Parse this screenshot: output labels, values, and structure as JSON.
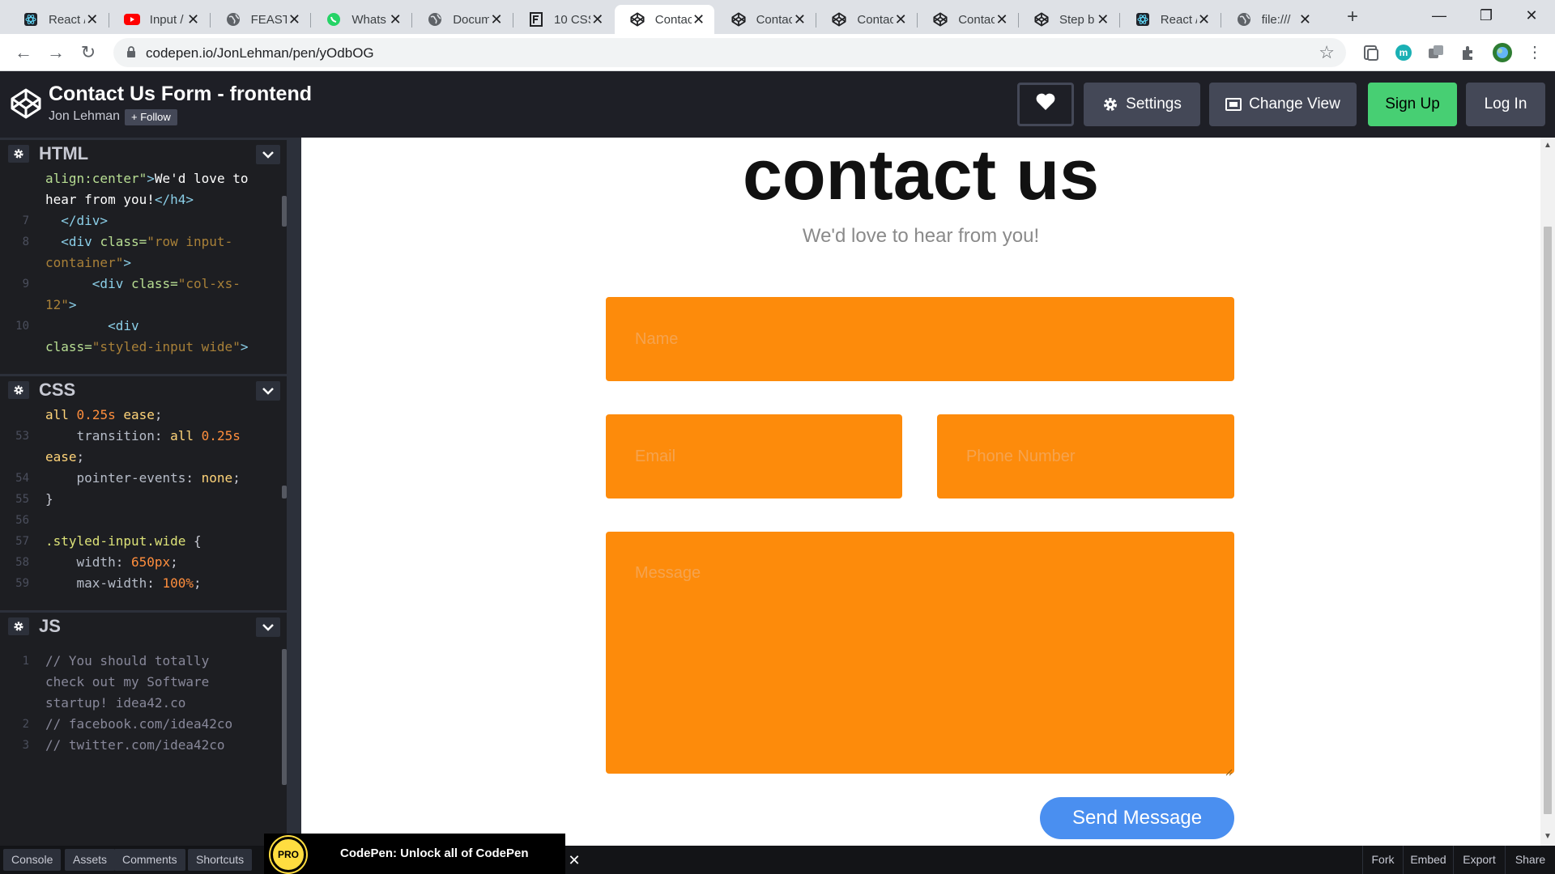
{
  "browser": {
    "tabs": [
      {
        "label": "React /",
        "icon": "react-icon"
      },
      {
        "label": "Input /",
        "icon": "youtube-icon"
      },
      {
        "label": "FEAST_",
        "icon": "globe-icon"
      },
      {
        "label": "Whats",
        "icon": "whatsapp-icon"
      },
      {
        "label": "Docum",
        "icon": "globe-icon"
      },
      {
        "label": "10 CSS",
        "icon": "fcc-icon"
      },
      {
        "label": "Contac",
        "icon": "codepen-icon",
        "active": true
      },
      {
        "label": "Contac",
        "icon": "codepen-icon"
      },
      {
        "label": "Contac",
        "icon": "codepen-icon"
      },
      {
        "label": "Contac",
        "icon": "codepen-icon"
      },
      {
        "label": "Step b",
        "icon": "codepen-icon"
      },
      {
        "label": "React /",
        "icon": "react-icon"
      },
      {
        "label": "file:///",
        "icon": "globe-icon"
      }
    ],
    "url": "codepen.io/JonLehman/pen/yOdbOG"
  },
  "header": {
    "title": "Contact Us Form - frontend",
    "author": "Jon Lehman",
    "follow_label": "+ Follow",
    "settings_label": "Settings",
    "change_view_label": "Change View",
    "signup_label": "Sign Up",
    "login_label": "Log In"
  },
  "panes": {
    "html": {
      "name": "HTML",
      "lines": [
        {
          "n": "",
          "html": "<span class=\"at\">align:center\"</span><span class=\"tg\">&gt;</span><span class=\"tx\">We'd love to</span>"
        },
        {
          "n": "",
          "html": "<span class=\"tx\">hear from you!</span><span class=\"tg\">&lt;/h4&gt;</span>"
        },
        {
          "n": "7",
          "html": "  <span class=\"tg\">&lt;/div&gt;</span>"
        },
        {
          "n": "8",
          "html": "  <span class=\"tg\">&lt;div</span> <span class=\"at\">class=</span><span class=\"st\">\"row input-</span>"
        },
        {
          "n": "",
          "html": "<span class=\"st\">container\"</span><span class=\"tg\">&gt;</span>"
        },
        {
          "n": "9",
          "html": "      <span class=\"tg\">&lt;div</span> <span class=\"at\">class=</span><span class=\"st\">\"col-xs-</span>"
        },
        {
          "n": "",
          "html": "<span class=\"st\">12\"</span><span class=\"tg\">&gt;</span>"
        },
        {
          "n": "10",
          "html": "        <span class=\"tg\">&lt;div</span>"
        },
        {
          "n": "",
          "html": "<span class=\"at\">class=</span><span class=\"st\">\"styled-input wide\"</span><span class=\"tg\">&gt;</span>"
        }
      ]
    },
    "css": {
      "name": "CSS",
      "lines": [
        {
          "n": "",
          "html": "<span class=\"vl\">all</span> <span class=\"num\">0.25s</span> <span class=\"vl\">ease</span>;"
        },
        {
          "n": "53",
          "html": "    <span class=\"pr\">transition</span>: <span class=\"vl\">all</span> <span class=\"num\">0.25s</span>"
        },
        {
          "n": "",
          "html": "<span class=\"vl\">ease</span>;"
        },
        {
          "n": "54",
          "html": "    <span class=\"pr\">pointer-events</span>: <span class=\"vl\">none</span>;"
        },
        {
          "n": "55",
          "html": "}"
        },
        {
          "n": "56",
          "html": ""
        },
        {
          "n": "57",
          "html": "<span class=\"sel\">.styled-input.wide</span> {"
        },
        {
          "n": "58",
          "html": "    <span class=\"pr\">width</span>: <span class=\"num\">650px</span>;"
        },
        {
          "n": "59",
          "html": "    <span class=\"pr\">max-width</span>: <span class=\"num\">100%</span>;"
        }
      ]
    },
    "js": {
      "name": "JS",
      "lines": [
        {
          "n": "1",
          "html": "<span class=\"cm\">// You should totally</span>"
        },
        {
          "n": "",
          "html": "<span class=\"cm\">check out my Software</span>"
        },
        {
          "n": "",
          "html": "<span class=\"cm\">startup! idea42.co</span>"
        },
        {
          "n": "2",
          "html": "<span class=\"cm\">// facebook.com/idea42co</span>"
        },
        {
          "n": "3",
          "html": "<span class=\"cm\">// twitter.com/idea42co</span>"
        }
      ]
    }
  },
  "preview": {
    "title": "contact us",
    "subtitle": "We'd love to hear from you!",
    "name_placeholder": "Name",
    "email_placeholder": "Email",
    "phone_placeholder": "Phone Number",
    "message_placeholder": "Message",
    "send_label": "Send Message"
  },
  "footer": {
    "console": "Console",
    "assets": "Assets",
    "comments": "Comments",
    "shortcuts": "Shortcuts",
    "fork": "Fork",
    "embed": "Embed",
    "export": "Export",
    "share": "Share",
    "promo_badge": "PRO",
    "promo_text": "CodePen: Unlock all of CodePen"
  },
  "colors": {
    "field_orange": "#fd8b0b",
    "send_blue": "#4a8ff0",
    "signup_green": "#47cf73",
    "header_bg": "#1e1f26"
  }
}
